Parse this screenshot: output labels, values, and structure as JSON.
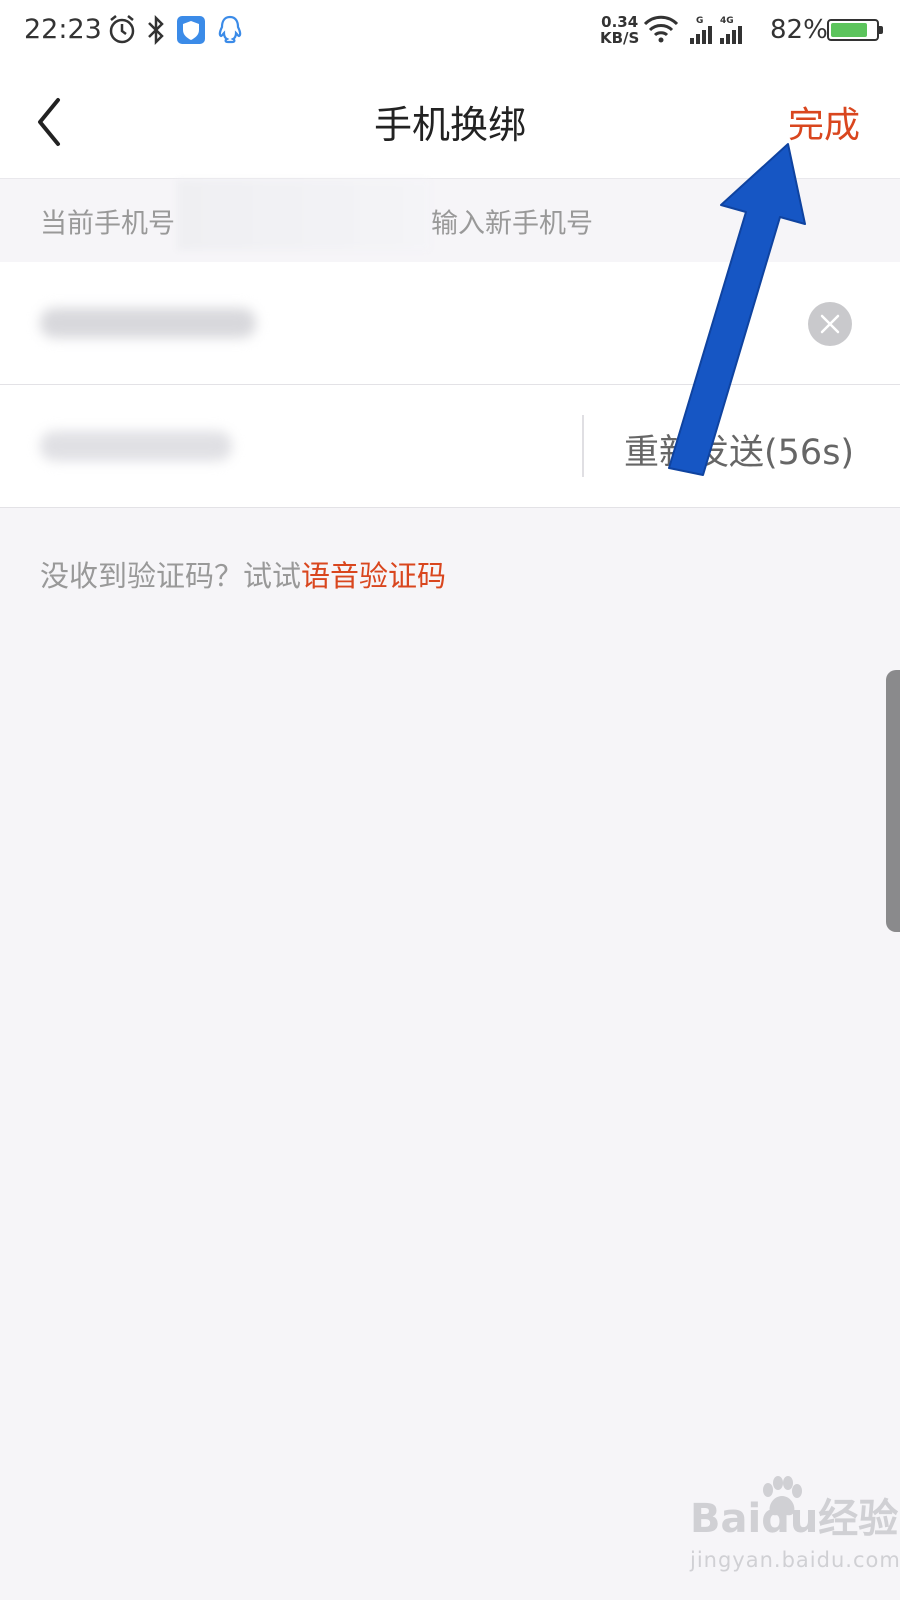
{
  "status_bar": {
    "time": "22:23",
    "net_speed": "0.34",
    "net_unit": "KB/S",
    "signal_label_1": "G",
    "signal_label_2": "4G",
    "battery_pct": "82%",
    "battery_level": 0.82,
    "icons": [
      "alarm-icon",
      "bluetooth-icon",
      "shield-icon",
      "qq-icon",
      "wifi-icon",
      "signal-icon",
      "battery-icon"
    ]
  },
  "navbar": {
    "title": "手机换绑",
    "done_label": "完成",
    "accent_color": "#d9461e"
  },
  "hint": {
    "prefix": "当前手机号",
    "suffix": "输入新手机号"
  },
  "form": {
    "resend_label": "重新发送(56s)"
  },
  "voice": {
    "text": "没收到验证码？试试",
    "link": "语音验证码"
  },
  "annotation": {
    "arrow_color": "#1656c4"
  },
  "watermark": {
    "main": "Baidu经验",
    "sub": "jingyan.baidu.com"
  }
}
